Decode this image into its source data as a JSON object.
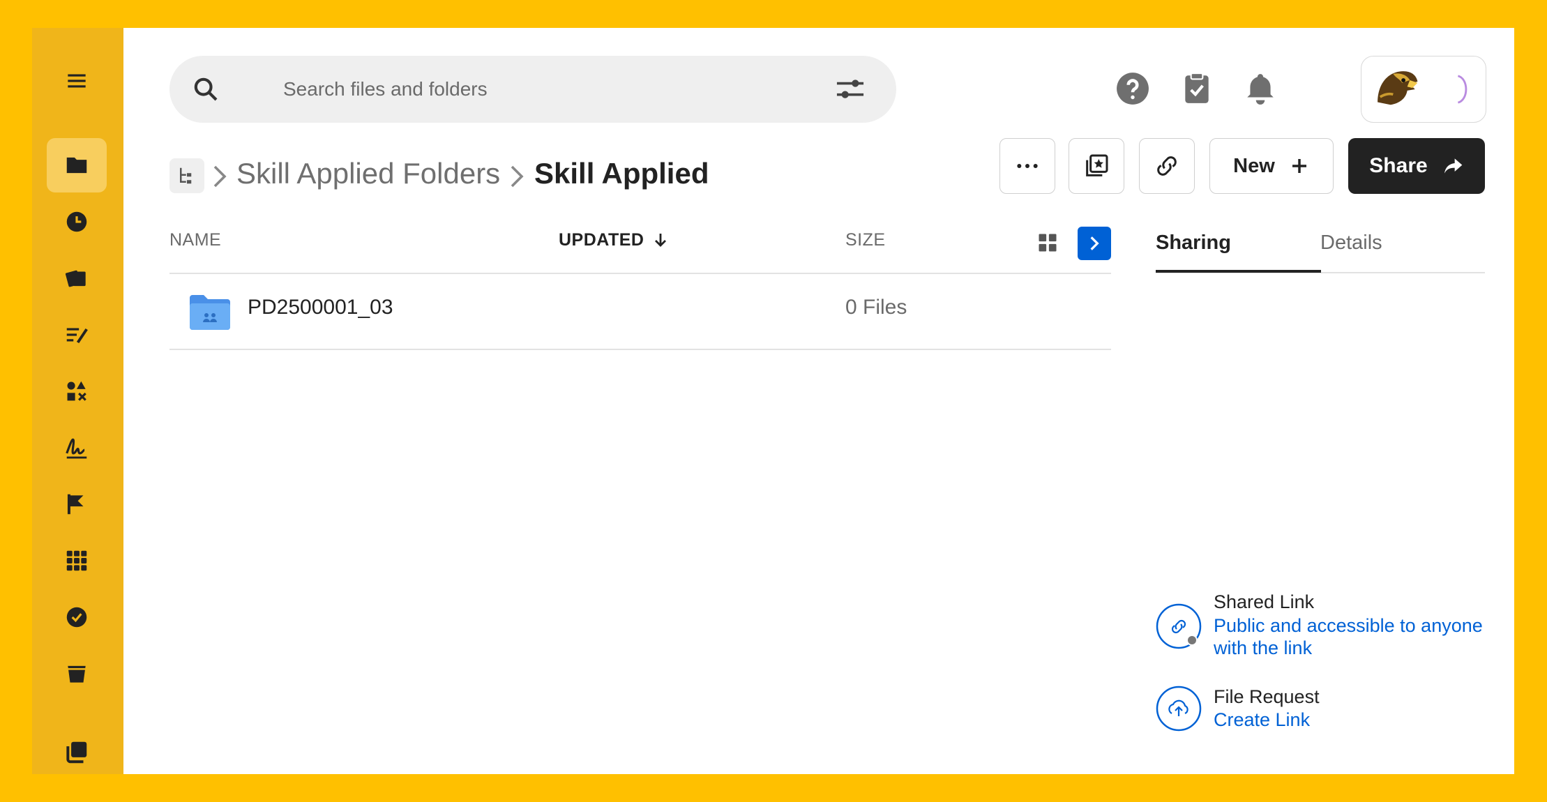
{
  "sidebar": {
    "items": [
      {
        "icon": "menu-icon"
      },
      {
        "icon": "folder-icon",
        "active": true
      },
      {
        "icon": "clock-icon"
      },
      {
        "icon": "collections-icon"
      },
      {
        "icon": "notes-icon"
      },
      {
        "icon": "apps-shapes-icon"
      },
      {
        "icon": "signature-icon"
      },
      {
        "icon": "flags-icon"
      },
      {
        "icon": "grid-apps-icon"
      },
      {
        "icon": "check-circle-icon"
      },
      {
        "icon": "trash-icon"
      },
      {
        "icon": "stack-icon"
      }
    ]
  },
  "search": {
    "placeholder": "Search files and folders"
  },
  "header": {
    "icons": [
      "help-icon",
      "tasks-icon",
      "bell-icon"
    ],
    "avatar": "eagle-avatar-icon"
  },
  "breadcrumb": {
    "items": [
      "Skill Applied Folders"
    ],
    "current": "Skill Applied"
  },
  "toolbar": {
    "more_icon": "ellipsis-icon",
    "collection_icon": "add-to-collection-icon",
    "link_icon": "link-icon",
    "new_label": "New",
    "share_label": "Share"
  },
  "table": {
    "columns": {
      "name": "NAME",
      "updated": "UPDATED",
      "size": "SIZE"
    },
    "sort": {
      "column": "updated",
      "direction": "descending"
    },
    "rows": [
      {
        "name": "PD2500001_03",
        "updated": "",
        "size": "0 Files",
        "icon": "shared-folder-icon"
      }
    ]
  },
  "side_panel": {
    "tabs": [
      {
        "label": "Sharing",
        "active": true
      },
      {
        "label": "Details",
        "active": false
      }
    ],
    "shared_link": {
      "title": "Shared Link",
      "link_text": "Public and accessible to anyone with the link"
    },
    "file_request": {
      "title": "File Request",
      "link_text": "Create Link"
    }
  },
  "colors": {
    "frame": "#FFC000",
    "sidebar": "#F0B51A",
    "accent": "#0061D5",
    "share_button": "#222222"
  }
}
